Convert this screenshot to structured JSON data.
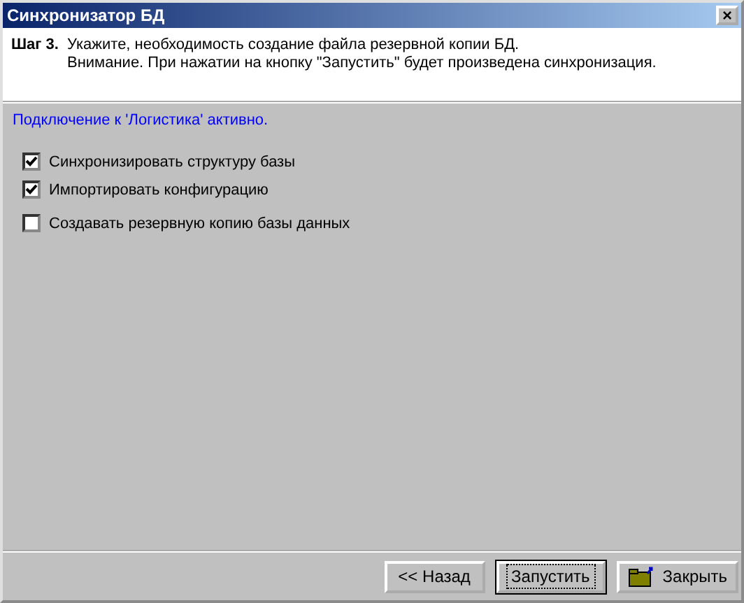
{
  "window": {
    "title": "Синхронизатор БД",
    "close": "×"
  },
  "header": {
    "step": "Шаг 3.",
    "lines": [
      "Укажите, необходимость создание файла резервной копии БД.",
      "Внимание. При нажатии на кнопку \"Запустить\" будет произведена синхронизация."
    ]
  },
  "status": "Подключение к 'Логистика' активно.",
  "options": [
    {
      "label": "Синхронизировать структуру базы",
      "checked": true
    },
    {
      "label": "Импортировать конфигурацию",
      "checked": true
    },
    {
      "label": "Создавать резервную копию базы данных",
      "checked": false
    }
  ],
  "buttons": [
    {
      "label": "<< Назад",
      "kind": "plain",
      "selected": false
    },
    {
      "label": "Запустить",
      "kind": "plain",
      "selected": true
    },
    {
      "label": "Закрыть",
      "kind": "close",
      "selected": false
    }
  ]
}
